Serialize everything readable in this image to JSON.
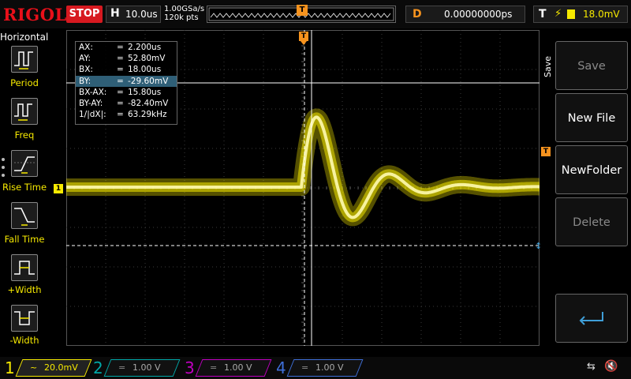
{
  "header": {
    "brand": "RIGOL",
    "run_state": "STOP",
    "timebase_label": "H",
    "timebase_value": "10.0us",
    "sample_rate": "1.00GSa/s",
    "memory_depth": "120k pts",
    "trigger_marker": "T",
    "delay_label": "D",
    "delay_value": "0.00000000ps",
    "trigger_label": "T",
    "trigger_edge": "⚡",
    "trigger_level": "18.0mV"
  },
  "left_menu": {
    "title": "Horizontal",
    "items": [
      {
        "label": "Period",
        "icon": "period-icon"
      },
      {
        "label": "Freq",
        "icon": "freq-icon"
      },
      {
        "label": "Rise Time",
        "icon": "rise-time-icon"
      },
      {
        "label": "Fall Time",
        "icon": "fall-time-icon"
      },
      {
        "label": "+Width",
        "icon": "positive-width-icon"
      },
      {
        "label": "-Width",
        "icon": "negative-width-icon"
      }
    ]
  },
  "cursors": {
    "rows": [
      {
        "key": "AX:",
        "value": "2.200us"
      },
      {
        "key": "AY:",
        "value": "52.80mV"
      },
      {
        "key": "BX:",
        "value": "18.00us"
      },
      {
        "key": "BY:",
        "value": "-29.60mV"
      },
      {
        "key": "BX-AX:",
        "value": "15.80us"
      },
      {
        "key": "BY-AY:",
        "value": "-82.40mV"
      },
      {
        "key": "1/|dX|:",
        "value": "63.29kHz"
      }
    ],
    "eq": "=",
    "selected_row": 3
  },
  "markers": {
    "channel1": "1",
    "trigger_level": "T",
    "trigger_position": "T"
  },
  "right_menu": {
    "tab": "Save",
    "buttons": [
      {
        "label": "Save",
        "enabled": false
      },
      {
        "label": "New File",
        "enabled": true
      },
      {
        "label": "NewFolder",
        "enabled": true
      },
      {
        "label": "Delete",
        "enabled": false
      },
      {
        "label": "",
        "icon": "enter-return-icon",
        "enabled": true
      }
    ]
  },
  "channels": [
    {
      "number": "1",
      "coupling": "~",
      "scale": "20.0mV",
      "color": "#f6e900",
      "active": true
    },
    {
      "number": "2",
      "coupling": "=",
      "scale": "1.00 V",
      "color": "#00a8a8",
      "active": false
    },
    {
      "number": "3",
      "coupling": "=",
      "scale": "1.00 V",
      "color": "#c000c0",
      "active": false
    },
    {
      "number": "4",
      "coupling": "=",
      "scale": "1.00 V",
      "color": "#3f6fd8",
      "active": false
    }
  ],
  "colors": {
    "trace": "#f6e900",
    "trigger": "#f7931e",
    "stop": "#d71920",
    "selected_row": "#2f5f77"
  }
}
